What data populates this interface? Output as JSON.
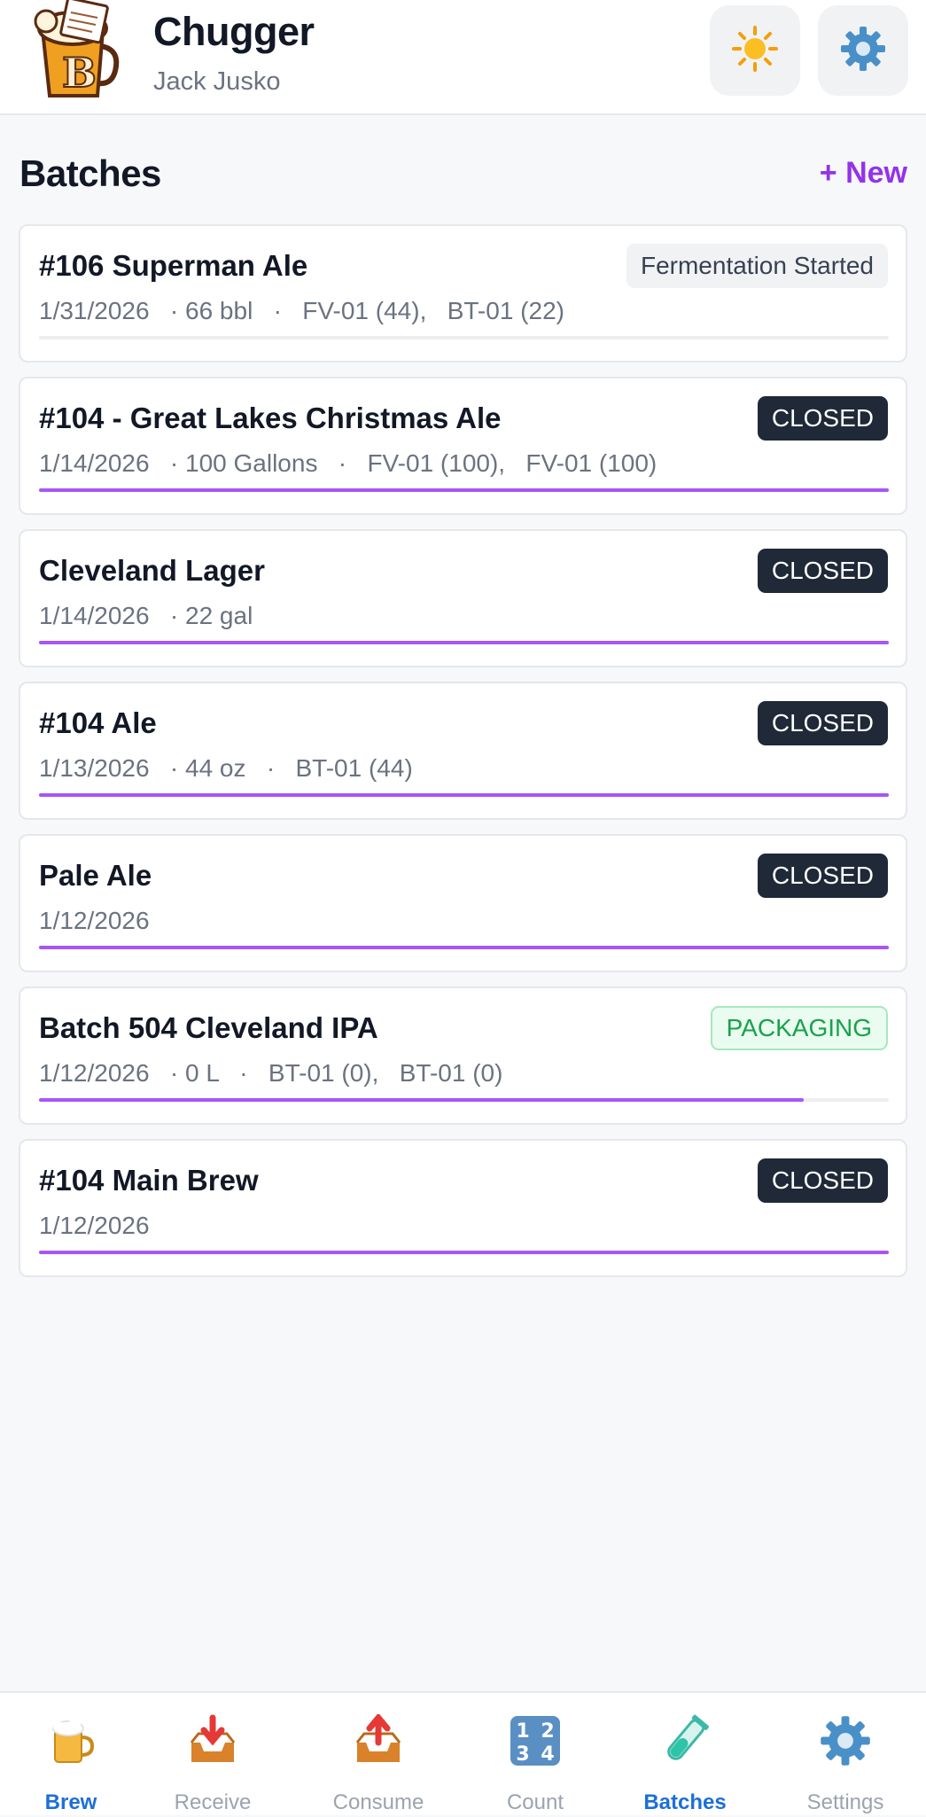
{
  "header": {
    "app_title": "Chugger",
    "user_name": "Jack Jusko"
  },
  "section": {
    "title": "Batches",
    "new_label": "+ New"
  },
  "colors": {
    "accent": "#a855f7",
    "new_link": "#9333ea",
    "closed_badge": "#1f2937",
    "packaging_badge": "#16a34a",
    "nav_active": "#1d6fd8"
  },
  "batches": [
    {
      "name": "#106 Superman Ale",
      "meta": "1/31/2026   · 66 bbl   ·   FV-01 (44),   BT-01 (22)",
      "status": "Fermentation Started",
      "status_type": "fermentation",
      "progress": 0
    },
    {
      "name": "#104 - Great Lakes Christmas Ale",
      "meta": "1/14/2026   · 100 Gallons   ·   FV-01 (100),   FV-01 (100)",
      "status": "CLOSED",
      "status_type": "closed",
      "progress": 1.0
    },
    {
      "name": "Cleveland Lager",
      "meta": "1/14/2026   · 22 gal",
      "status": "CLOSED",
      "status_type": "closed",
      "progress": 1.0
    },
    {
      "name": "#104 Ale",
      "meta": "1/13/2026   · 44 oz   ·   BT-01 (44)",
      "status": "CLOSED",
      "status_type": "closed",
      "progress": 1.0
    },
    {
      "name": "Pale Ale",
      "meta": "1/12/2026",
      "status": "CLOSED",
      "status_type": "closed",
      "progress": 1.0
    },
    {
      "name": "Batch 504 Cleveland IPA",
      "meta": "1/12/2026   · 0 L   ·   BT-01 (0),   BT-01 (0)",
      "status": "PACKAGING",
      "status_type": "packaging",
      "progress": 0.9
    },
    {
      "name": "#104 Main Brew",
      "meta": "1/12/2026",
      "status": "CLOSED",
      "status_type": "closed",
      "progress": 1.0
    }
  ],
  "nav": {
    "items": [
      {
        "label": "Brew",
        "icon": "beer-mug-icon",
        "active": true
      },
      {
        "label": "Receive",
        "icon": "inbox-receive-icon",
        "active": false
      },
      {
        "label": "Consume",
        "icon": "outbox-consume-icon",
        "active": false
      },
      {
        "label": "Count",
        "icon": "numbers-keycap-icon",
        "active": false
      },
      {
        "label": "Batches",
        "icon": "test-tube-icon",
        "active": true
      },
      {
        "label": "Settings",
        "icon": "gear-icon",
        "active": false
      }
    ]
  }
}
